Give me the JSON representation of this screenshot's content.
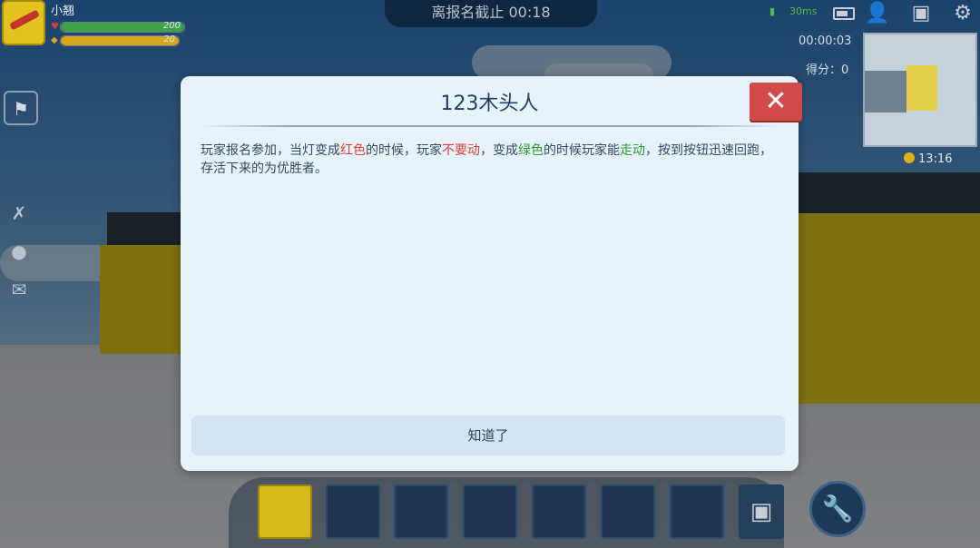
{
  "hud": {
    "player_name": "小翘",
    "health_value": "200",
    "hunger_value": "20",
    "countdown_text": "离报名截止 00:18",
    "network_text": "30ms",
    "elapsed_time": "00:00:03",
    "score_text": "得分：0",
    "coin_time": "13:16",
    "health_fill_fraction": 1.0,
    "hunger_fill_fraction": 1.0
  },
  "colors": {
    "health": "#3fa24a",
    "hunger": "#d7a722",
    "close_button": "#d24a47",
    "highlight_red": "#e23c37",
    "highlight_green": "#2d9a2a"
  },
  "dialog": {
    "title": "123木头人",
    "close_label": "✕",
    "body": {
      "seg1": "玩家报名参加，当灯变成",
      "seg2_red": "红色",
      "seg3": "的时候，玩家",
      "seg4_red": "不要动",
      "seg5": "，变成",
      "seg6_green": "绿色",
      "seg7": "的时候玩家能",
      "seg8_green": "走动",
      "seg9": "，按到按钮迅速回跑，存活下来的为优胜者。"
    },
    "ok_label": "知道了"
  },
  "icons": {
    "settings": "gear-icon",
    "screenshot": "camera-frame-icon",
    "friends": "friend-icon",
    "flag": "flag-icon",
    "tool": "wrench-icon",
    "bag": "backpack-icon"
  }
}
